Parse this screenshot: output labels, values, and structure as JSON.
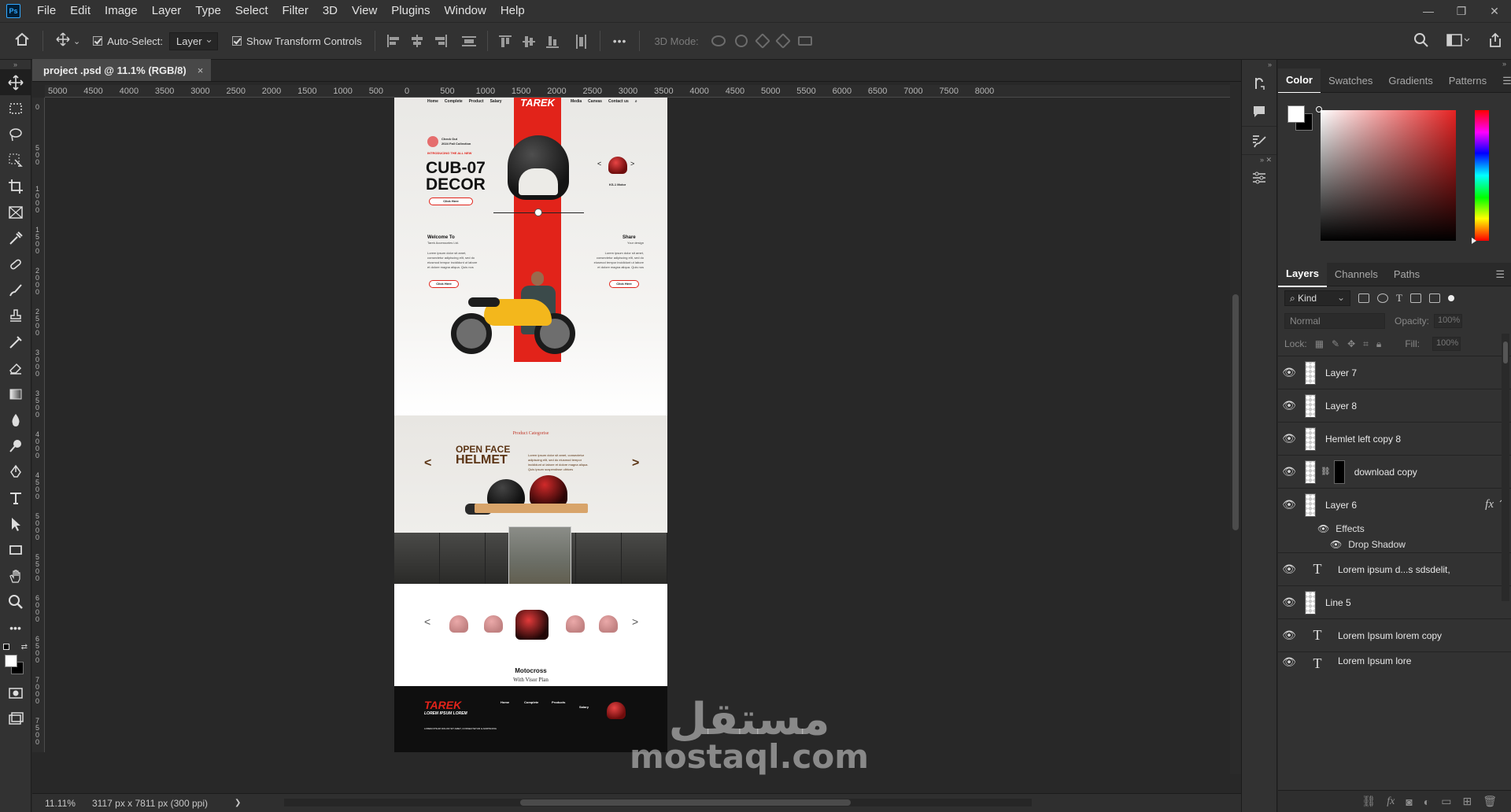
{
  "app": {
    "logo": "Ps"
  },
  "menu": [
    "File",
    "Edit",
    "Image",
    "Layer",
    "Type",
    "Select",
    "Filter",
    "3D",
    "View",
    "Plugins",
    "Window",
    "Help"
  ],
  "window_controls": {
    "minimize": "—",
    "restore": "❐",
    "close": "✕"
  },
  "options": {
    "auto_select_label": "Auto-Select:",
    "auto_select_value": "Layer",
    "show_transform_label": "Show Transform Controls",
    "more": "•••",
    "mode_3d": "3D Mode:"
  },
  "document": {
    "tab_title": "project .psd @ 11.1% (RGB/8)",
    "tab_close": "×",
    "zoom": "11.11%",
    "size_info": "3117 px x 7811 px (300 ppi)",
    "status_arrow": "❯"
  },
  "ruler_h": [
    "5000",
    "4500",
    "4000",
    "3500",
    "3000",
    "2500",
    "2000",
    "1500",
    "1000",
    "500",
    "0",
    "500",
    "1000",
    "1500",
    "2000",
    "2500",
    "3000",
    "3500",
    "4000",
    "4500",
    "5000",
    "5500",
    "6000",
    "6500",
    "7000",
    "7500",
    "8000"
  ],
  "ruler_v": [
    "0",
    "500",
    "1000",
    "1500",
    "2000",
    "2500",
    "3000",
    "3500",
    "4000",
    "4500",
    "5000",
    "5500",
    "6000",
    "6500",
    "7000",
    "7500"
  ],
  "design": {
    "brand": "TAREK",
    "nav_left": [
      "Home",
      "Complete",
      "Product",
      "Salary"
    ],
    "nav_right": [
      "Media",
      "Canvas",
      "Contact us"
    ],
    "badge_line1": "Check Out",
    "badge_line2": "2024 Fall Collection",
    "intro": "INTRODUCING THE ALL NEW",
    "headline1": "CUB-07",
    "headline2": "DECOR",
    "click_here": "Click Here",
    "side_model": "KS-1 Motor",
    "welcome_title": "Welcome To",
    "welcome_sub": "Tarek Accessories Ltd.",
    "share_title": "Share",
    "share_sub": "Your design",
    "lorem": "Lorem ipsum dolor sit amet, consectetur adipiscing elit, sed do eiusmod tempor incididunt ut labore et dolore magna aliqua. Quis nos",
    "category_title": "Product Categorise",
    "ofh_line1": "OPEN FACE",
    "ofh_line2": "HELMET",
    "ofh_text": "Lorem ipsum dolor sit amet, consectetur adipiscing elit, sed do eiusmod tempor incididunt ut labore et dolore magna aliqua. Quis ipsum suspendisse ultrices",
    "arrow_left": "<",
    "arrow_right": ">",
    "moto_title": "Motocross",
    "moto_sub": "With Visor Plan",
    "footer_brand": "TAREK",
    "footer_sub": "LOREM IPSUM LOREM",
    "footer_cols": [
      "Home",
      "Complete",
      "Products",
      "Salary"
    ],
    "footer_note": "LOREM IPSUM DOLOR SIT AMET, CONSECTETUR & ADIPISCING"
  },
  "color_panel": {
    "tabs": [
      "Color",
      "Swatches",
      "Gradients",
      "Patterns"
    ],
    "active": "Color",
    "fg": "#ffffff",
    "bg": "#000000"
  },
  "layers_panel": {
    "tabs": [
      "Layers",
      "Channels",
      "Paths"
    ],
    "active": "Layers",
    "kind": "Kind",
    "blend": "Normal",
    "opacity_label": "Opacity:",
    "opacity_value": "100%",
    "lock_label": "Lock:",
    "fill_label": "Fill:",
    "fill_value": "100%",
    "layers": [
      {
        "name": "Layer 7",
        "type": "pixel"
      },
      {
        "name": "Layer 8",
        "type": "pixel"
      },
      {
        "name": "Hemlet left copy 8",
        "type": "pixel"
      },
      {
        "name": "download copy",
        "type": "masked"
      },
      {
        "name": "Layer 6",
        "type": "pixel",
        "fx": "fx"
      },
      {
        "name": "Lorem ipsum d...s sdsdelit,",
        "type": "text"
      },
      {
        "name": "Line 5",
        "type": "shape"
      },
      {
        "name": "Lorem Ipsum lorem copy",
        "type": "text"
      },
      {
        "name": "Lorem Ipsum lore",
        "type": "text"
      }
    ],
    "effects_label": "Effects",
    "drop_shadow_label": "Drop Shadow",
    "text_glyph": "T"
  },
  "watermark": {
    "arabic": "مستقل",
    "latin": "mostaql.com"
  }
}
